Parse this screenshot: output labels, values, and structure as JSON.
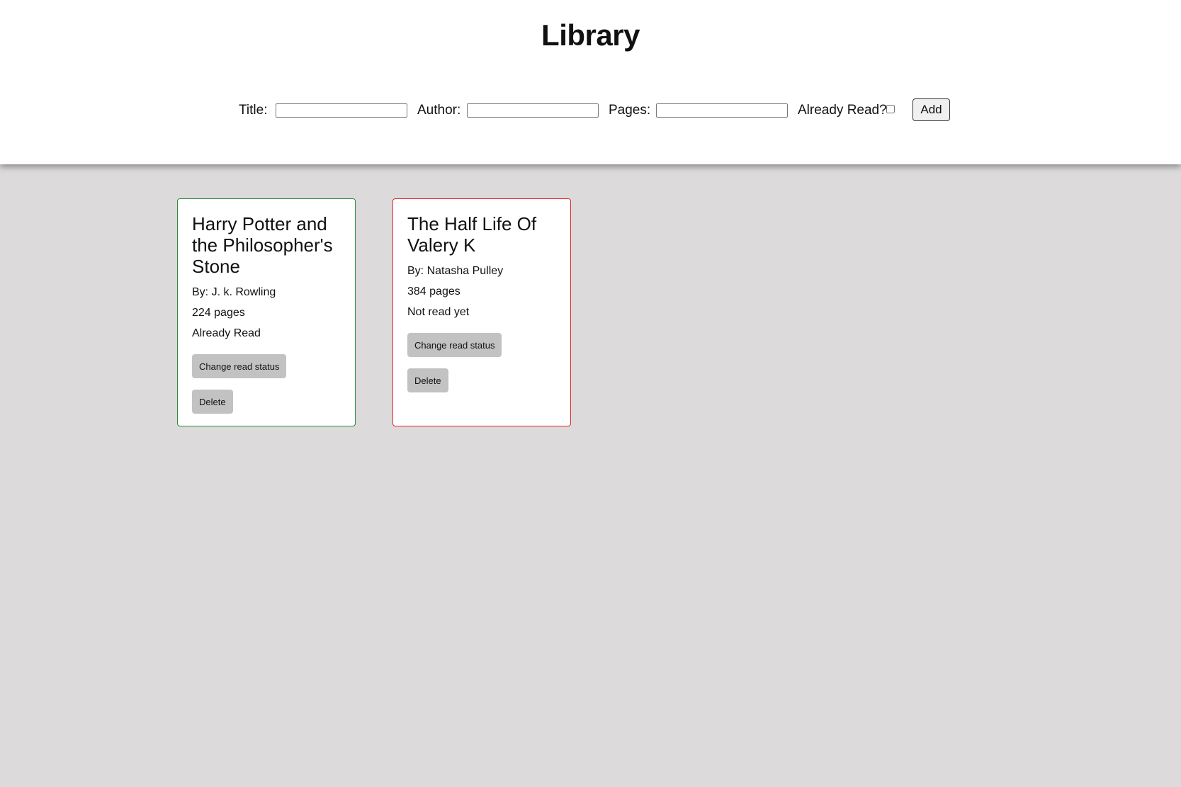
{
  "header": {
    "title": "Library"
  },
  "form": {
    "title_label": "Title:",
    "author_label": "Author:",
    "pages_label": "Pages:",
    "read_label": "Already Read?",
    "add_label": "Add",
    "title_value": "",
    "author_value": "",
    "pages_value": "",
    "read_checked": false
  },
  "books": [
    {
      "title": "Harry Potter and the Philosopher's Stone",
      "author": "By: J. k. Rowling",
      "pages": "224 pages",
      "status": "Already Read",
      "read": true,
      "change_label": "Change read status",
      "delete_label": "Delete"
    },
    {
      "title": "The Half Life Of Valery K",
      "author": "By: Natasha Pulley",
      "pages": "384 pages",
      "status": "Not read yet",
      "read": false,
      "change_label": "Change read status",
      "delete_label": "Delete"
    }
  ],
  "colors": {
    "read_border": "#2e8b3a",
    "unread_border": "#e0262e",
    "background": "#dcdadb",
    "button_bg": "#c3c2c3"
  }
}
